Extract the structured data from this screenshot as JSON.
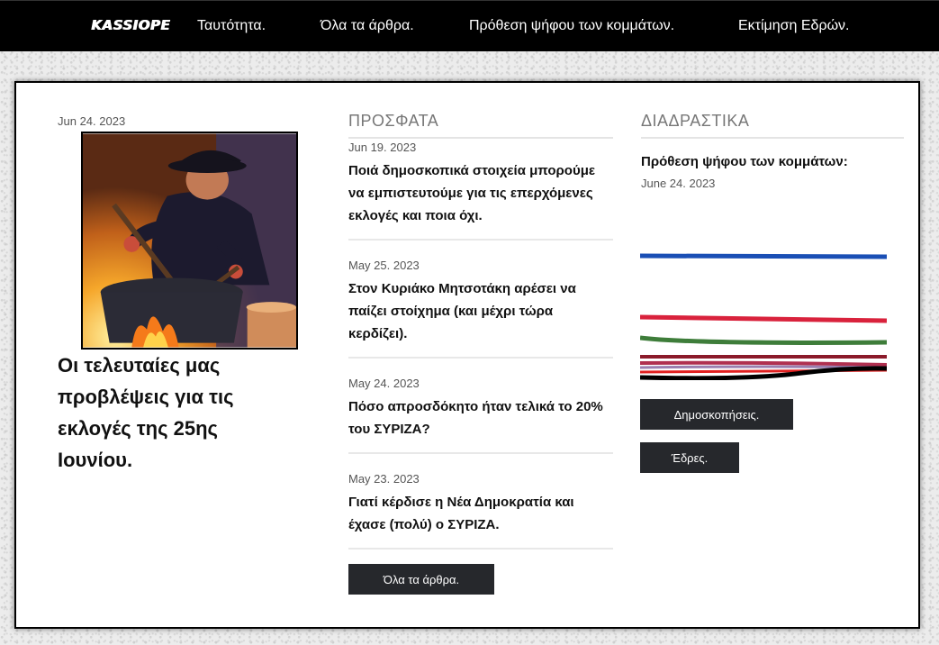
{
  "nav": {
    "logo": "KASSIOPE",
    "links": [
      "Ταυτότητα.",
      "Όλα τα άρθρα.",
      "Πρόθεση ψήφου των κομμάτων.",
      "Εκτίμηση Εδρών."
    ]
  },
  "feature": {
    "date": "Jun 24. 2023",
    "title": "Οι τελευταίες μας προβλέψεις για τις εκλογές της 25ης Ιουνίου.",
    "image_icon": "cook-stirring-pot-illustration"
  },
  "recent": {
    "heading": "ΠΡΟΣΦΑΤΑ",
    "articles": [
      {
        "date": "Jun 19. 2023",
        "title": "Ποιά δημοσκοπικά στοιχεία μπορούμε να εμπιστευτούμε για τις επερχόμενες εκλογές και ποια όχι."
      },
      {
        "date": "May 25. 2023",
        "title": "Στον Κυριάκο Μητσοτάκη αρέσει να παίζει στοίχημα (και μέχρι τώρα κερδίζει)."
      },
      {
        "date": "May 24. 2023",
        "title": "Πόσο απροσδόκητο ήταν τελικά το 20% του ΣΥΡΙΖΑ?"
      },
      {
        "date": "May 23. 2023",
        "title": "Γιατί κέρδισε η Νέα Δημοκρατία και έχασε (πολύ) ο ΣΥΡΙΖΑ."
      }
    ],
    "all_articles_button": "Όλα τα άρθρα."
  },
  "interactive": {
    "heading": "ΔΙΑΔΡΑΣΤΙΚΑ",
    "title": "Πρόθεση ψήφου των κομμάτων:",
    "date": "June 24. 2023",
    "polls_button": "Δημοσκοπήσεις.",
    "seats_button": "Έδρες.",
    "trend_colors": [
      "#1a4fb5",
      "#d9223c",
      "#3e7d3a",
      "#8b1a2a",
      "#b03050",
      "#9a7fb0",
      "#e02020",
      "#000000"
    ]
  }
}
